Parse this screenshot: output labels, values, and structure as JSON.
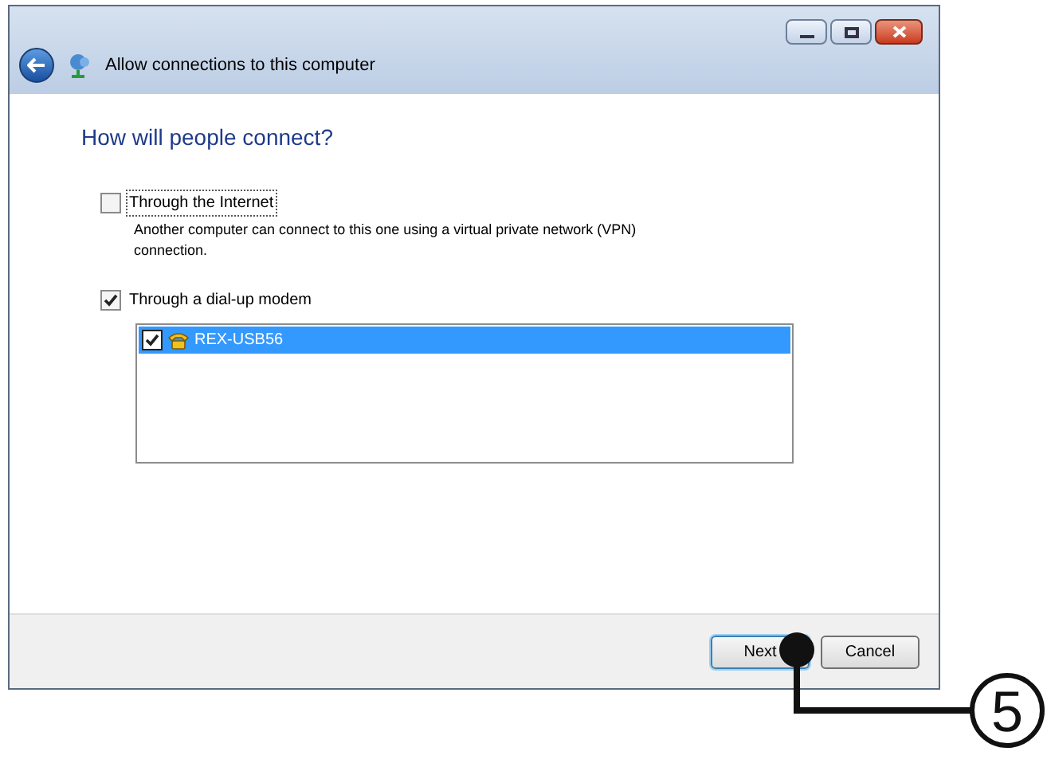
{
  "window": {
    "title": "Allow connections to this computer"
  },
  "heading": "How will people connect?",
  "options": [
    {
      "label": "Through the Internet",
      "checked": false,
      "focused": true,
      "description": "Another computer can connect to this one using a virtual private network (VPN) connection."
    },
    {
      "label": "Through a dial-up modem",
      "checked": true,
      "focused": false
    }
  ],
  "devices": [
    {
      "name": "REX-USB56",
      "checked": true,
      "selected": true
    }
  ],
  "buttons": [
    {
      "label": "Next",
      "default": true
    },
    {
      "label": "Cancel",
      "default": false
    }
  ],
  "callout": {
    "label": "5"
  }
}
